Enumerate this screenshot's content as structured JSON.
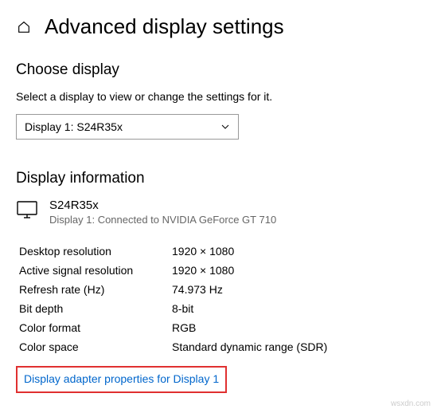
{
  "header": {
    "title": "Advanced display settings"
  },
  "choose_display": {
    "heading": "Choose display",
    "subtext": "Select a display to view or change the settings for it.",
    "selected": "Display 1: S24R35x"
  },
  "display_information": {
    "heading": "Display information",
    "name": "S24R35x",
    "connection": "Display 1: Connected to NVIDIA GeForce GT 710",
    "rows": [
      {
        "label": "Desktop resolution",
        "value": "1920 × 1080"
      },
      {
        "label": "Active signal resolution",
        "value": "1920 × 1080"
      },
      {
        "label": "Refresh rate (Hz)",
        "value": "74.973 Hz"
      },
      {
        "label": "Bit depth",
        "value": "8-bit"
      },
      {
        "label": "Color format",
        "value": "RGB"
      },
      {
        "label": "Color space",
        "value": "Standard dynamic range (SDR)"
      }
    ],
    "adapter_link": "Display adapter properties for Display 1"
  },
  "watermark": "wsxdn.com"
}
